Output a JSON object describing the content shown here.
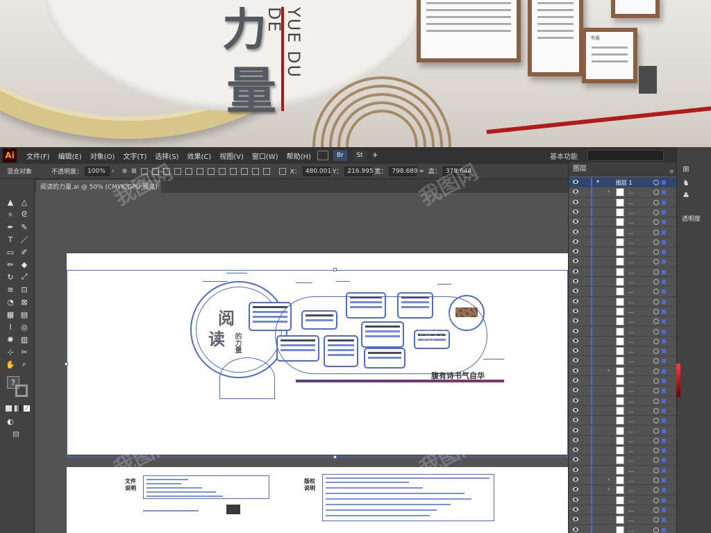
{
  "photo": {
    "big_chars": [
      "力",
      "量"
    ],
    "vertical_text": "YUE DU DE",
    "panel_label": "书香"
  },
  "menubar": {
    "logo": "Ai",
    "items": [
      "文件(F)",
      "编辑(E)",
      "对象(O)",
      "文字(T)",
      "选择(S)",
      "效果(C)",
      "视图(V)",
      "窗口(W)",
      "帮助(H)"
    ],
    "bridge": "Br",
    "stock": "St",
    "workspace": "基本功能"
  },
  "controlbar": {
    "mixed_objects": "混合对象",
    "opacity_label": "不透明度：",
    "opacity_value": "100%",
    "x_label": "X：",
    "x_value": "480.001",
    "y_label": "Y：",
    "y_value": "216.995",
    "w_label": "宽：",
    "w_value": "798.689",
    "h_label": "高：",
    "h_value": "378.644"
  },
  "document": {
    "tab_title": "阅读的力量.ai @ 50% (CMYK/GPU 预览)",
    "close": "×"
  },
  "artwork": {
    "title_chars": [
      "阅",
      "读"
    ],
    "sub_chars": "的力量",
    "slogan": "腹有诗书气自华",
    "file_note_head": [
      "文件",
      "说明"
    ],
    "copyright_head": [
      "版权",
      "说明"
    ]
  },
  "layers": {
    "tab": "图层",
    "menu": "≡",
    "top_layer": "图层 1"
  },
  "right_dock": {
    "opacity_label": "透明度"
  },
  "watermark": "我图网",
  "colors": {
    "selection": "#4a6cd4",
    "menubar": "#323232",
    "panel": "#535353",
    "accent_red": "#a8191b"
  }
}
